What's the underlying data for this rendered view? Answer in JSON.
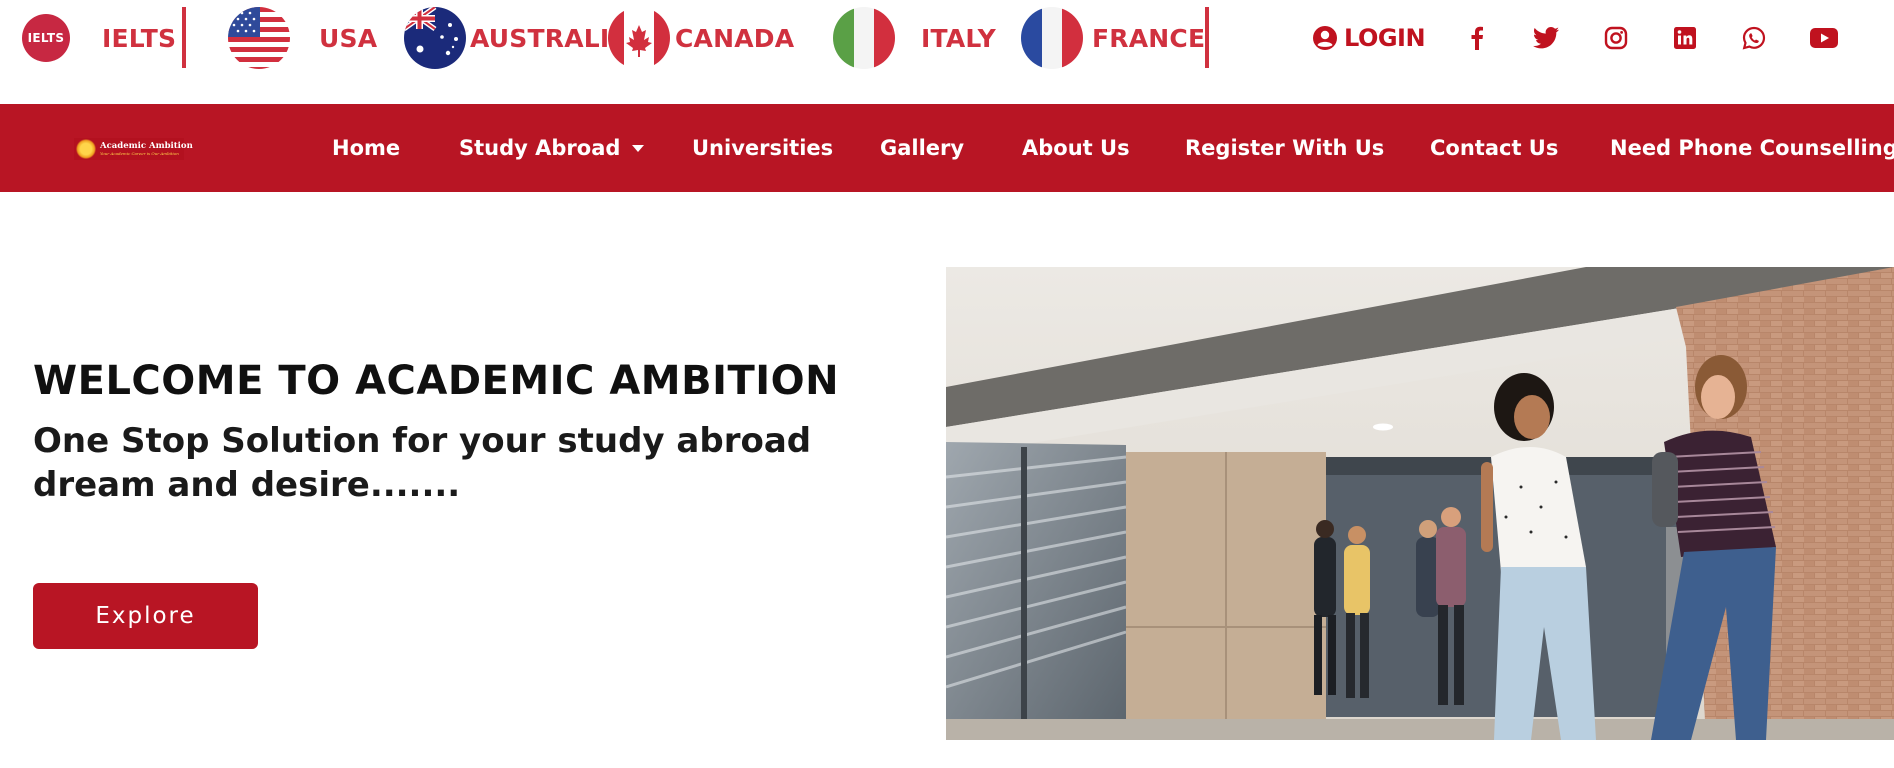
{
  "topbar": {
    "ielts": {
      "badge": "IELTS",
      "label": "IELTS"
    },
    "countries": [
      {
        "label": "USA",
        "flag_icon": "usa-flag-icon"
      },
      {
        "label": "AUSTRALIA",
        "flag_icon": "australia-flag-icon"
      },
      {
        "label": "CANADA",
        "flag_icon": "canada-flag-icon"
      },
      {
        "label": "ITALY",
        "flag_icon": "italy-flag-icon"
      },
      {
        "label": "FRANCE",
        "flag_icon": "france-flag-icon"
      }
    ],
    "login_label": "LOGIN",
    "social": [
      "facebook-icon",
      "twitter-icon",
      "instagram-icon",
      "linkedin-icon",
      "whatsapp-icon",
      "youtube-icon"
    ]
  },
  "nav": {
    "logo": {
      "title": "Academic Ambition",
      "tagline": "Your Academic Career is Our Ambition"
    },
    "items": [
      {
        "label": "Home"
      },
      {
        "label": "Study Abroad"
      },
      {
        "label": "Universities"
      },
      {
        "label": "Gallery"
      },
      {
        "label": "About Us"
      },
      {
        "label": "Register With Us"
      },
      {
        "label": "Contact Us"
      },
      {
        "label": "Need Phone Counselling?"
      }
    ]
  },
  "hero": {
    "title": "WELCOME TO ACADEMIC AMBITION",
    "subtitle": "One Stop Solution for your study abroad dream and desire.......",
    "cta_label": "Explore"
  },
  "colors": {
    "brand_red": "#b81524",
    "topbar_red": "#d0313f",
    "text_dark": "#101010"
  }
}
